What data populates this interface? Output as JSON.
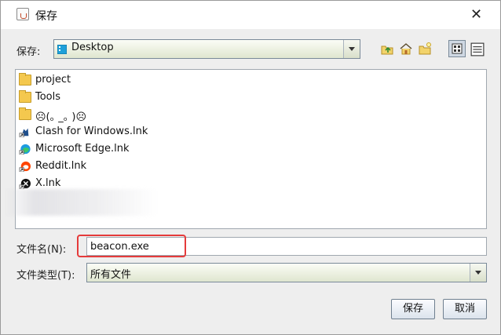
{
  "window": {
    "title": "保存"
  },
  "toolbar": {
    "save_in_label": "保存:",
    "folder": "Desktop",
    "icons": [
      "up-folder-icon",
      "home-icon",
      "new-folder-icon",
      "list-view-icon",
      "details-view-icon"
    ]
  },
  "files": [
    {
      "name": "project",
      "icon": "folder-icon"
    },
    {
      "name": "Tools",
      "icon": "folder-icon"
    },
    {
      "name": "☹(｡ _｡ )☹",
      "icon": "folder-icon"
    },
    {
      "name": "Clash for Windows.lnk",
      "icon": "clash-icon"
    },
    {
      "name": "Microsoft Edge.lnk",
      "icon": "edge-icon"
    },
    {
      "name": "Reddit.lnk",
      "icon": "reddit-icon"
    },
    {
      "name": "X.lnk",
      "icon": "x-icon"
    }
  ],
  "filename": {
    "label": "文件名(N):",
    "value": "beacon.exe"
  },
  "filetype": {
    "label": "文件类型(T):",
    "value": "所有文件"
  },
  "buttons": {
    "save": "保存",
    "cancel": "取消"
  },
  "colors": {
    "highlight": "#e53b3b",
    "combo_bg": "#e6ecd9"
  }
}
